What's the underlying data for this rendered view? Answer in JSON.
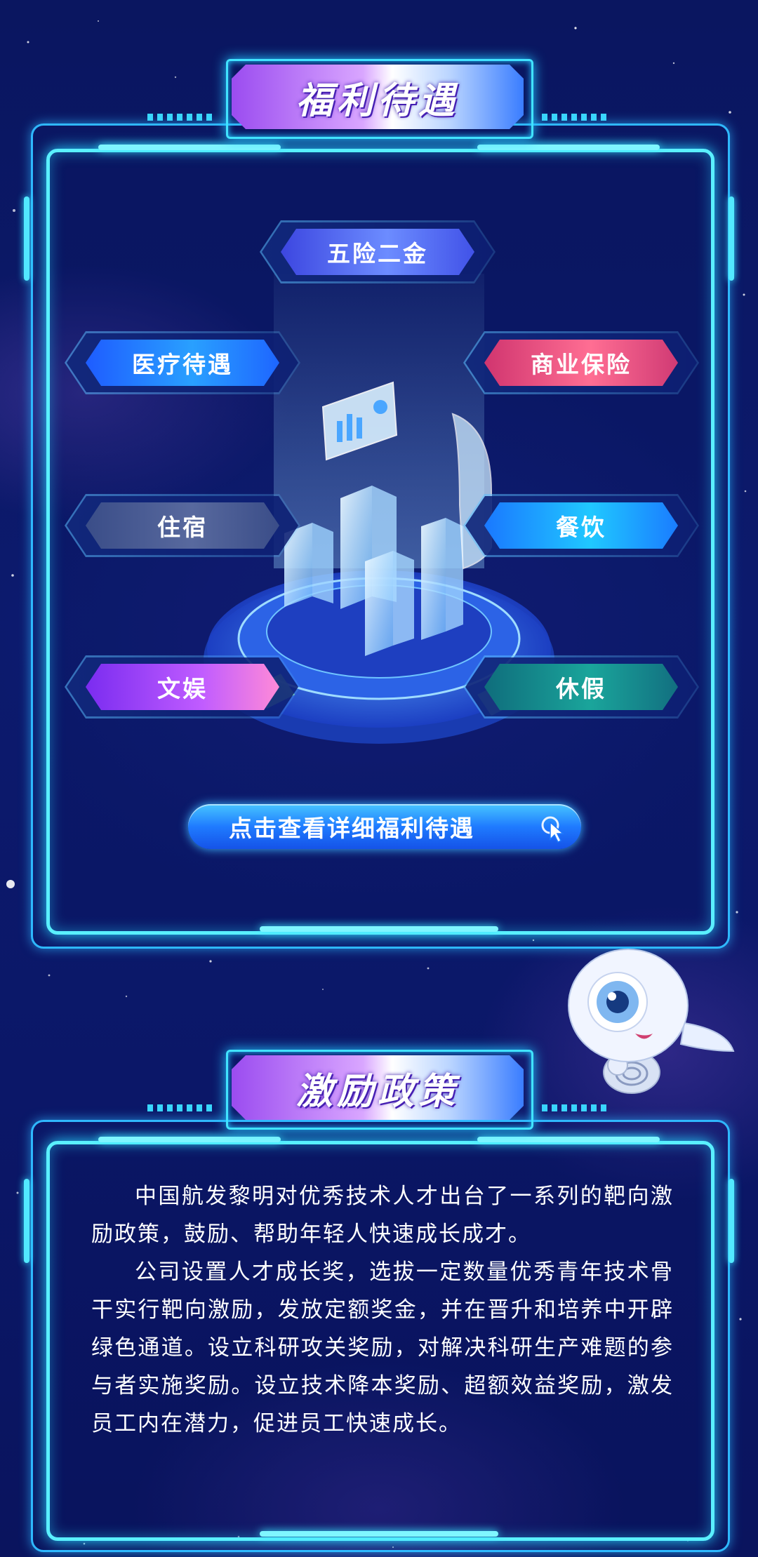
{
  "sections": {
    "benefits": {
      "title": "福利待遇",
      "tags": [
        {
          "label": "五险二金",
          "style": "violet"
        },
        {
          "label": "医疗待遇",
          "style": "blue"
        },
        {
          "label": "商业保险",
          "style": "red"
        },
        {
          "label": "住宿",
          "style": "gray"
        },
        {
          "label": "餐饮",
          "style": "cyan"
        },
        {
          "label": "文娱",
          "style": "purple"
        },
        {
          "label": "休假",
          "style": "teal"
        }
      ],
      "cta_label": "点击查看详细福利待遇"
    },
    "incentives": {
      "title": "激励政策",
      "paragraphs": [
        "中国航发黎明对优秀技术人才出台了一系列的靶向激励政策，鼓励、帮助年轻人快速成长成才。",
        "公司设置人才成长奖，选拔一定数量优秀青年技术骨干实行靶向激励，发放定额奖金，并在晋升和培养中开辟绿色通道。设立科研攻关奖励，对解决科研生产难题的参与者实施奖励。设立技术降本奖励、超额效益奖励，激发员工内在潜力，促进员工快速成长。"
      ]
    }
  },
  "colors": {
    "background": "#0b1768",
    "frame_glow": "#5af0ff",
    "banner_gradient_start": "#9b4cf0",
    "banner_gradient_end": "#3a7dff"
  },
  "icons": [
    "pointer-cursor-icon",
    "data-dashboard-illustration",
    "mascot-robot"
  ]
}
